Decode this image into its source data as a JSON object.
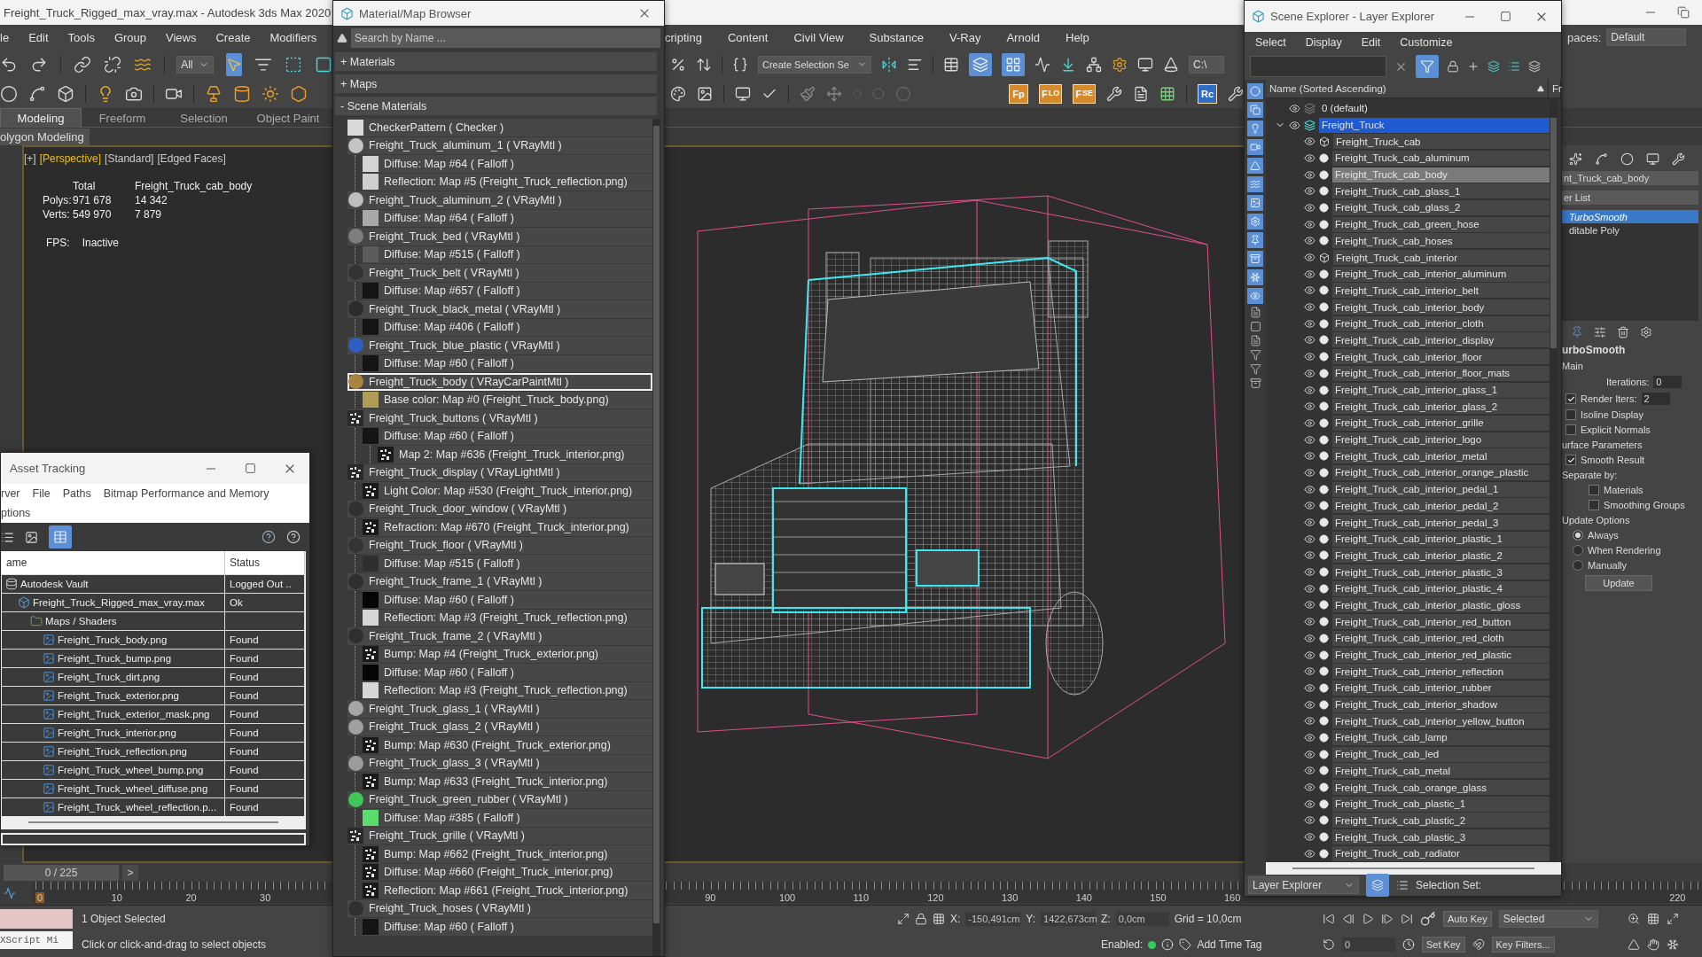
{
  "main_window": {
    "title": "Freight_Truck_Rigged_max_vray.max - Autodesk 3ds Max 2020"
  },
  "menu_left": [
    "le",
    "Edit",
    "Tools",
    "Group",
    "Views",
    "Create",
    "Modifiers"
  ],
  "menu_right": [
    "cripting",
    "Content",
    "Civil View",
    "Substance",
    "V-Ray",
    "Arnold",
    "Help"
  ],
  "workspaces": {
    "label": "paces:",
    "value": "Default"
  },
  "toolbar": {
    "selection_filter": "All",
    "selection_set": "Create Selection Se",
    "path": "C:\\",
    "plugin_buttons": [
      {
        "label": "Fp"
      },
      {
        "label": "F",
        "sub": "LO"
      },
      {
        "label": "F",
        "sub": "SE"
      }
    ],
    "render_button": "Rc"
  },
  "ribbon_tabs": [
    {
      "label": "Modeling",
      "selected": true
    },
    {
      "label": "Freeform",
      "selected": false
    },
    {
      "label": "Selection",
      "selected": false
    },
    {
      "label": "Object Paint",
      "selected": false
    }
  ],
  "ribbon_panel": "olygon Modeling",
  "viewport": {
    "labels": [
      {
        "text": "[+]",
        "active": false
      },
      {
        "text": "[Perspective]",
        "active": true
      },
      {
        "text": "[Standard]",
        "active": false
      },
      {
        "text": "[Edged Faces]",
        "active": false
      }
    ],
    "stats": {
      "header": [
        "Total",
        "Freight_Truck_cab_body"
      ],
      "rows": [
        {
          "label": "Polys:",
          "total": "971 678",
          "object": "14 342"
        },
        {
          "label": "Verts:",
          "total": "549 970",
          "object": "7 879"
        }
      ],
      "fps_label": "FPS:",
      "fps": "Inactive"
    }
  },
  "command_panel": {
    "object_name": "nt_Truck_cab_body",
    "modifier_list": "er List",
    "stack": [
      {
        "label": "TurboSmooth",
        "selected": true
      },
      {
        "label": "ditable Poly",
        "selected": false
      }
    ],
    "rollout": "urboSmooth",
    "section": "Main",
    "iterations": {
      "label": "Iterations:",
      "value": "0"
    },
    "render_iters": {
      "label": "Render Iters:",
      "value": "2",
      "checked": true
    },
    "options": [
      {
        "label": "Isoline Display",
        "checked": false
      },
      {
        "label": "Explicit Normals",
        "checked": false
      }
    ],
    "surface_title": "urface Parameters",
    "smooth_result": {
      "label": "Smooth Result",
      "checked": true
    },
    "separate_label": "Separate by:",
    "separate": [
      {
        "label": "Materials",
        "checked": false
      },
      {
        "label": "Smoothing Groups",
        "checked": false
      }
    ],
    "update_title": "Update Options",
    "update_modes": [
      {
        "label": "Always",
        "selected": true
      },
      {
        "label": "When Rendering",
        "selected": false
      },
      {
        "label": "Manually",
        "selected": false
      }
    ],
    "update_button": "Update"
  },
  "material_browser": {
    "title": "Material/Map Browser",
    "search_placeholder": "Search by Name ...",
    "groups": [
      {
        "label": "+ Materials"
      },
      {
        "label": "+ Maps"
      },
      {
        "label": "- Scene Materials"
      }
    ],
    "items": [
      {
        "label": "CheckerPattern  ( Checker )",
        "kind": "flat",
        "color": "#d9d9d9",
        "selected": false
      },
      {
        "label": "Freight_Truck_aluminum_1  ( VRayMtl )",
        "kind": "sphere",
        "color": "#c4c4c4",
        "selected": false,
        "children": [
          {
            "label": "Diffuse: Map #64  ( Falloff )",
            "kind": "flat",
            "color": "#d4d4d4",
            "selected": false
          },
          {
            "label": "Reflection: Map #5 (Freight_Truck_reflection.png)",
            "kind": "flat",
            "color": "#cfcfcf",
            "selected": false
          }
        ]
      },
      {
        "label": "Freight_Truck_aluminum_2  ( VRayMtl )",
        "kind": "sphere",
        "color": "#bdbdbd",
        "selected": false,
        "children": [
          {
            "label": "Diffuse: Map #64  ( Falloff )",
            "kind": "flat",
            "color": "#a9a9a9",
            "selected": false
          }
        ]
      },
      {
        "label": "Freight_Truck_bed  ( VRayMtl )",
        "kind": "sphere",
        "color": "#7e7e7e",
        "selected": false,
        "children": [
          {
            "label": "Diffuse: Map #515  ( Falloff )",
            "kind": "flat",
            "color": "#5c5c5c",
            "selected": false
          }
        ]
      },
      {
        "label": "Freight_Truck_belt  ( VRayMtl )",
        "kind": "sphere",
        "color": "#333333",
        "selected": false,
        "children": [
          {
            "label": "Diffuse: Map #657  ( Falloff )",
            "kind": "flat",
            "color": "#151515",
            "selected": false
          }
        ]
      },
      {
        "label": "Freight_Truck_black_metal  ( VRayMtl )",
        "kind": "sphere",
        "color": "#2c2c2c",
        "selected": false,
        "children": [
          {
            "label": "Diffuse: Map #406  ( Falloff )",
            "kind": "flat",
            "color": "#151515",
            "selected": false
          }
        ]
      },
      {
        "label": "Freight_Truck_blue_plastic  ( VRayMtl )",
        "kind": "sphere",
        "color": "#2d5fc4",
        "selected": false,
        "children": [
          {
            "label": "Diffuse: Map #60  ( Falloff )",
            "kind": "flat",
            "color": "#151515",
            "selected": false
          }
        ]
      },
      {
        "label": "Freight_Truck_body  ( VRayCarPaintMtl )",
        "kind": "sphere",
        "color": "#a8843f",
        "selected": true,
        "children": [
          {
            "label": "Base color: Map #0 (Freight_Truck_body.png)",
            "kind": "flat",
            "color": "#b19c55",
            "selected": false
          }
        ]
      },
      {
        "label": "Freight_Truck_buttons  ( VRayMtl )",
        "kind": "bitmap",
        "color": "#2a2a2a",
        "selected": false,
        "children": [
          {
            "label": "Diffuse: Map #60  ( Falloff )",
            "kind": "flat",
            "color": "#151515",
            "selected": false,
            "children": [
              {
                "label": "Map 2: Map #636 (Freight_Truck_interior.png)",
                "kind": "bitmap",
                "color": "#1a1a1a",
                "selected": false
              }
            ]
          }
        ]
      },
      {
        "label": "Freight_Truck_display  ( VRayLightMtl )",
        "kind": "bitmap",
        "color": "#2a2a2a",
        "selected": false,
        "children": [
          {
            "label": "Light Color: Map #530 (Freight_Truck_interior.png)",
            "kind": "bitmap",
            "color": "#1a1a1a",
            "selected": false
          }
        ]
      },
      {
        "label": "Freight_Truck_door_window  ( VRayMtl )",
        "kind": "sphere",
        "color": "#303030",
        "selected": false,
        "children": [
          {
            "label": "Refraction: Map #670 (Freight_Truck_interior.png)",
            "kind": "bitmap",
            "color": "#1a1a1a",
            "selected": false
          }
        ]
      },
      {
        "label": "Freight_Truck_floor  ( VRayMtl )",
        "kind": "sphere",
        "color": "#343434",
        "selected": false,
        "children": [
          {
            "label": "Diffuse: Map #515  ( Falloff )",
            "kind": "flat",
            "color": "#2e2e2e",
            "selected": false
          }
        ]
      },
      {
        "label": "Freight_Truck_frame_1  ( VRayMtl )",
        "kind": "sphere",
        "color": "#2f2f2f",
        "selected": false,
        "children": [
          {
            "label": "Diffuse: Map #60  ( Falloff )",
            "kind": "flat",
            "color": "#050505",
            "selected": false
          },
          {
            "label": "Reflection: Map #3 (Freight_Truck_reflection.png)",
            "kind": "flat",
            "color": "#d6d6d6",
            "selected": false
          }
        ]
      },
      {
        "label": "Freight_Truck_frame_2  ( VRayMtl )",
        "kind": "sphere",
        "color": "#2f2f2f",
        "selected": false,
        "children": [
          {
            "label": "Bump: Map #4 (Freight_Truck_exterior.png)",
            "kind": "bitmap",
            "color": "#1a1a1a",
            "selected": false
          },
          {
            "label": "Diffuse: Map #60  ( Falloff )",
            "kind": "flat",
            "color": "#050505",
            "selected": false
          },
          {
            "label": "Reflection: Map #3 (Freight_Truck_reflection.png)",
            "kind": "flat",
            "color": "#d6d6d6",
            "selected": false
          }
        ]
      },
      {
        "label": "Freight_Truck_glass_1  ( VRayMtl )",
        "kind": "sphere",
        "color": "#a6a6a6",
        "selected": false
      },
      {
        "label": "Freight_Truck_glass_2  ( VRayMtl )",
        "kind": "sphere",
        "color": "#a0a0a0",
        "selected": false,
        "children": [
          {
            "label": "Bump: Map #630 (Freight_Truck_exterior.png)",
            "kind": "bitmap",
            "color": "#1a1a1a",
            "selected": false
          }
        ]
      },
      {
        "label": "Freight_Truck_glass_3  ( VRayMtl )",
        "kind": "sphere",
        "color": "#9c9c9c",
        "selected": false,
        "children": [
          {
            "label": "Bump: Map #633 (Freight_Truck_interior.png)",
            "kind": "bitmap",
            "color": "#1a1a1a",
            "selected": false
          }
        ]
      },
      {
        "label": "Freight_Truck_green_rubber  ( VRayMtl )",
        "kind": "sphere",
        "color": "#3fc75a",
        "selected": false,
        "children": [
          {
            "label": "Diffuse: Map #385  ( Falloff )",
            "kind": "flat",
            "color": "#5bdc6f",
            "selected": false
          }
        ]
      },
      {
        "label": "Freight_Truck_grille  ( VRayMtl )",
        "kind": "bitmap",
        "color": "#2a2a2a",
        "selected": false,
        "children": [
          {
            "label": "Bump: Map #662 (Freight_Truck_interior.png)",
            "kind": "bitmap",
            "color": "#1a1a1a",
            "selected": false
          },
          {
            "label": "Diffuse: Map #660 (Freight_Truck_interior.png)",
            "kind": "bitmap",
            "color": "#1a1a1a",
            "selected": false
          },
          {
            "label": "Reflection: Map #661 (Freight_Truck_interior.png)",
            "kind": "bitmap",
            "color": "#1a1a1a",
            "selected": false
          }
        ]
      },
      {
        "label": "Freight_Truck_hoses  ( VRayMtl )",
        "kind": "sphere",
        "color": "#2f2f2f",
        "selected": false,
        "children": [
          {
            "label": "Diffuse: Map #60  ( Falloff )",
            "kind": "flat",
            "color": "#151515",
            "selected": false
          }
        ]
      }
    ]
  },
  "scene_explorer": {
    "title": "Scene Explorer - Layer Explorer",
    "menu": [
      "Select",
      "Display",
      "Edit",
      "Customize"
    ],
    "column": "Name (Sorted Ascending)",
    "column_2": "Fr",
    "layers": [
      {
        "label": "0 (default)",
        "current": false,
        "selected": false
      },
      {
        "label": "Freight_Truck",
        "current": true,
        "selected": true,
        "expanded": true,
        "children": [
          {
            "label": "Freight_Truck_cab",
            "kind": "container",
            "selected": false
          },
          {
            "label": "Freight_Truck_cab_aluminum",
            "kind": "object",
            "selected": false
          },
          {
            "label": "Freight_Truck_cab_body",
            "kind": "object",
            "selected": true
          },
          {
            "label": "Freight_Truck_cab_glass_1",
            "kind": "object",
            "selected": false
          },
          {
            "label": "Freight_Truck_cab_glass_2",
            "kind": "object",
            "selected": false
          },
          {
            "label": "Freight_Truck_cab_green_hose",
            "kind": "object",
            "selected": false
          },
          {
            "label": "Freight_Truck_cab_hoses",
            "kind": "object",
            "selected": false
          },
          {
            "label": "Freight_Truck_cab_interior",
            "kind": "container",
            "selected": false
          },
          {
            "label": "Freight_Truck_cab_interior_aluminum",
            "kind": "object",
            "selected": false
          },
          {
            "label": "Freight_Truck_cab_interior_belt",
            "kind": "object",
            "selected": false
          },
          {
            "label": "Freight_Truck_cab_interior_body",
            "kind": "object",
            "selected": false
          },
          {
            "label": "Freight_Truck_cab_interior_cloth",
            "kind": "object",
            "selected": false
          },
          {
            "label": "Freight_Truck_cab_interior_display",
            "kind": "object",
            "selected": false
          },
          {
            "label": "Freight_Truck_cab_interior_floor",
            "kind": "object",
            "selected": false
          },
          {
            "label": "Freight_Truck_cab_interior_floor_mats",
            "kind": "object",
            "selected": false
          },
          {
            "label": "Freight_Truck_cab_interior_glass_1",
            "kind": "object",
            "selected": false
          },
          {
            "label": "Freight_Truck_cab_interior_glass_2",
            "kind": "object",
            "selected": false
          },
          {
            "label": "Freight_Truck_cab_interior_grille",
            "kind": "object",
            "selected": false
          },
          {
            "label": "Freight_Truck_cab_interior_logo",
            "kind": "object",
            "selected": false
          },
          {
            "label": "Freight_Truck_cab_interior_metal",
            "kind": "object",
            "selected": false
          },
          {
            "label": "Freight_Truck_cab_interior_orange_plastic",
            "kind": "object",
            "selected": false
          },
          {
            "label": "Freight_Truck_cab_interior_pedal_1",
            "kind": "object",
            "selected": false
          },
          {
            "label": "Freight_Truck_cab_interior_pedal_2",
            "kind": "object",
            "selected": false
          },
          {
            "label": "Freight_Truck_cab_interior_pedal_3",
            "kind": "object",
            "selected": false
          },
          {
            "label": "Freight_Truck_cab_interior_plastic_1",
            "kind": "object",
            "selected": false
          },
          {
            "label": "Freight_Truck_cab_interior_plastic_2",
            "kind": "object",
            "selected": false
          },
          {
            "label": "Freight_Truck_cab_interior_plastic_3",
            "kind": "object",
            "selected": false
          },
          {
            "label": "Freight_Truck_cab_interior_plastic_4",
            "kind": "object",
            "selected": false
          },
          {
            "label": "Freight_Truck_cab_interior_plastic_gloss",
            "kind": "object",
            "selected": false
          },
          {
            "label": "Freight_Truck_cab_interior_red_button",
            "kind": "object",
            "selected": false
          },
          {
            "label": "Freight_Truck_cab_interior_red_cloth",
            "kind": "object",
            "selected": false
          },
          {
            "label": "Freight_Truck_cab_interior_red_plastic",
            "kind": "object",
            "selected": false
          },
          {
            "label": "Freight_Truck_cab_interior_reflection",
            "kind": "object",
            "selected": false
          },
          {
            "label": "Freight_Truck_cab_interior_rubber",
            "kind": "object",
            "selected": false
          },
          {
            "label": "Freight_Truck_cab_interior_shadow",
            "kind": "object",
            "selected": false
          },
          {
            "label": "Freight_Truck_cab_interior_yellow_button",
            "kind": "object",
            "selected": false
          },
          {
            "label": "Freight_Truck_cab_lamp",
            "kind": "object",
            "selected": false
          },
          {
            "label": "Freight_Truck_cab_led",
            "kind": "object",
            "selected": false
          },
          {
            "label": "Freight_Truck_cab_metal",
            "kind": "object",
            "selected": false
          },
          {
            "label": "Freight_Truck_cab_orange_glass",
            "kind": "object",
            "selected": false
          },
          {
            "label": "Freight_Truck_cab_plastic_1",
            "kind": "object",
            "selected": false
          },
          {
            "label": "Freight_Truck_cab_plastic_2",
            "kind": "object",
            "selected": false
          },
          {
            "label": "Freight_Truck_cab_plastic_3",
            "kind": "object",
            "selected": false
          },
          {
            "label": "Freight_Truck_cab_radiator",
            "kind": "object",
            "selected": false
          }
        ]
      }
    ],
    "footer": {
      "mode": "Layer Explorer",
      "selection_set_label": "Selection Set:"
    }
  },
  "asset_tracking": {
    "title": "Asset Tracking",
    "menu": [
      "rver",
      "File",
      "Paths",
      "Bitmap Performance and Memory"
    ],
    "menu_line_2": [
      "ptions"
    ],
    "columns": [
      "ame",
      "Status"
    ],
    "rows": [
      {
        "name": "Autodesk Vault",
        "status": "Logged Out ..",
        "kind": "vault",
        "children": [
          {
            "name": "Freight_Truck_Rigged_max_vray.max",
            "status": "Ok",
            "kind": "scene",
            "children": [
              {
                "name": "Maps / Shaders",
                "kind": "folder",
                "children": [
                  {
                    "name": "Freight_Truck_body.png",
                    "status": "Found",
                    "kind": "file"
                  },
                  {
                    "name": "Freight_Truck_bump.png",
                    "status": "Found",
                    "kind": "file"
                  },
                  {
                    "name": "Freight_Truck_dirt.png",
                    "status": "Found",
                    "kind": "file"
                  },
                  {
                    "name": "Freight_Truck_exterior.png",
                    "status": "Found",
                    "kind": "file"
                  },
                  {
                    "name": "Freight_Truck_exterior_mask.png",
                    "status": "Found",
                    "kind": "file"
                  },
                  {
                    "name": "Freight_Truck_interior.png",
                    "status": "Found",
                    "kind": "file"
                  },
                  {
                    "name": "Freight_Truck_reflection.png",
                    "status": "Found",
                    "kind": "file"
                  },
                  {
                    "name": "Freight_Truck_wheel_bump.png",
                    "status": "Found",
                    "kind": "file"
                  },
                  {
                    "name": "Freight_Truck_wheel_diffuse.png",
                    "status": "Found",
                    "kind": "file"
                  },
                  {
                    "name": "Freight_Truck_wheel_reflection.p...",
                    "status": "Found",
                    "kind": "file"
                  }
                ]
              }
            ]
          }
        ]
      }
    ]
  },
  "timeline": {
    "frame": "0 / 225",
    "next": ">",
    "ruler_labels": [
      "0",
      "10",
      "20",
      "30",
      "90",
      "100",
      "110",
      "120",
      "130",
      "140",
      "150",
      "160",
      "220"
    ]
  },
  "status_bar": {
    "script_listener": "XScript Mi",
    "selection": "1 Object Selected",
    "prompt": "Click or click-and-drag to select objects",
    "coords": [
      {
        "axis": "X:",
        "value": "-150,491cm"
      },
      {
        "axis": "Y:",
        "value": "1422,673cm"
      },
      {
        "axis": "Z:",
        "value": "0,0cm"
      }
    ],
    "grid": "Grid = 10,0cm",
    "enabled_label": "Enabled:",
    "time_tag": "Add Time Tag",
    "auto_key": "Auto Key",
    "key_mode": "Selected",
    "set_key": "Set Key",
    "key_filters": "Key Filters...",
    "current_frame": "0"
  }
}
